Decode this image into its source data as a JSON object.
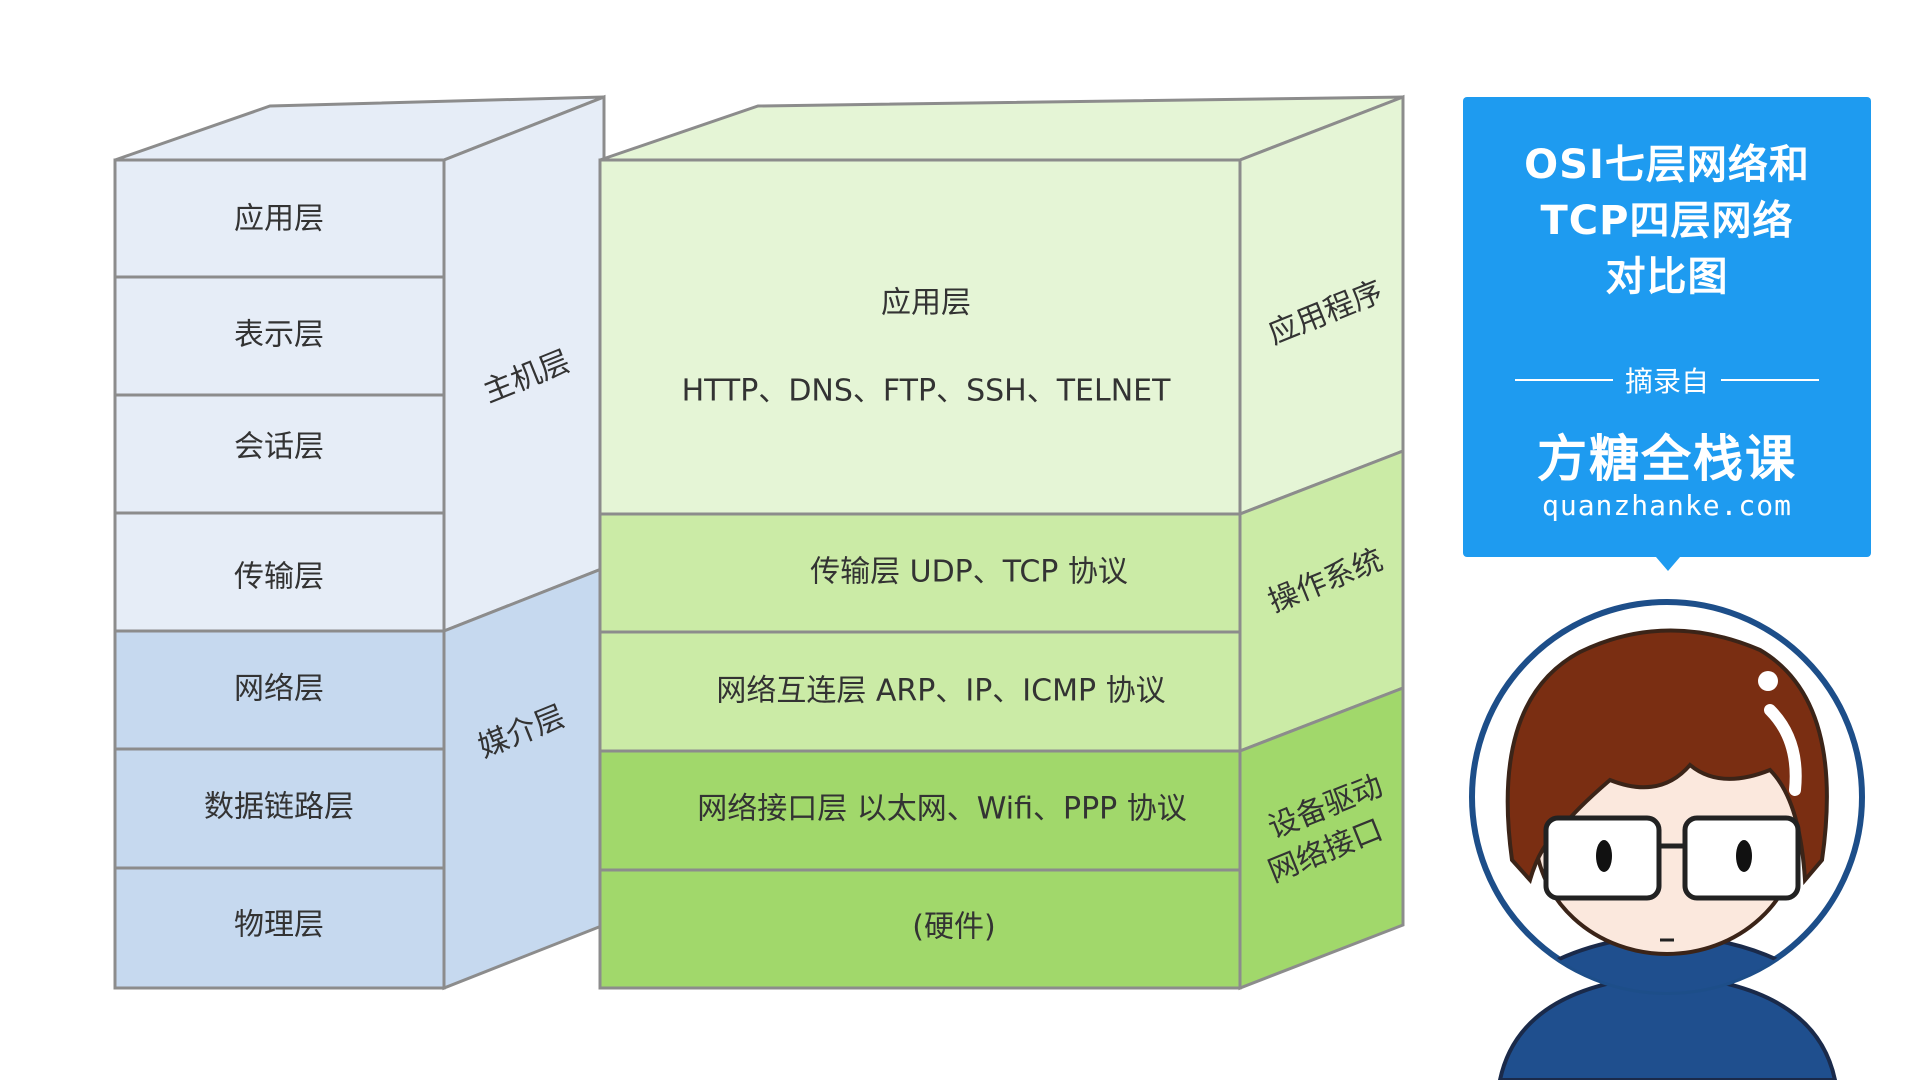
{
  "osi": {
    "layers": [
      "应用层",
      "表示层",
      "会话层",
      "传输层",
      "网络层",
      "数据链路层",
      "物理层"
    ],
    "group_host": "主机层",
    "group_media": "媒介层"
  },
  "tcp": {
    "layers": [
      {
        "name": "应用层",
        "detail": "HTTP、DNS、FTP、SSH、TELNET"
      },
      {
        "name": "传输层 UDP、TCP 协议"
      },
      {
        "name": "网络互连层 ARP、IP、ICMP 协议"
      },
      {
        "name": "网络接口层  以太网、Wifi、PPP 协议"
      },
      {
        "name": "(硬件)"
      }
    ],
    "side_labels": [
      "应用程序",
      "操作系统",
      "设备驱动",
      "网络接口"
    ]
  },
  "title_box": {
    "line1": "OSI七层网络和",
    "line2": "TCP四层网络",
    "line3": "对比图",
    "excerpt": "摘录自",
    "brand": "方糖全栈课",
    "domain": "quanzhanke.com"
  },
  "colors": {
    "osi_host": "#e6edf7",
    "osi_media": "#c6d9ef",
    "tcp_app": "#e5f5d6",
    "tcp_mid": "#cbeba6",
    "tcp_low": "#a1d86b",
    "accent_blue": "#1e9bf0",
    "border": "#8c8c8c",
    "text": "#333333"
  },
  "icons": [
    "cartoon-avatar-icon"
  ]
}
